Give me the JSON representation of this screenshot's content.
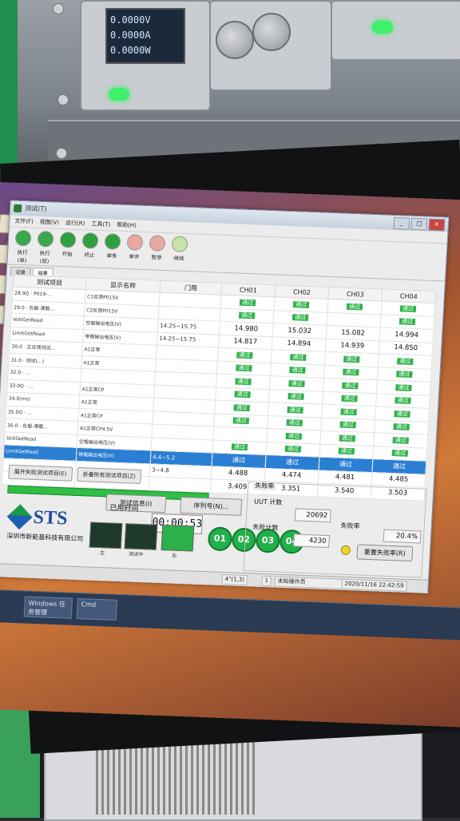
{
  "instrument": {
    "lcd_lines": [
      "0.0000V",
      "0.0000A",
      "0.0000W"
    ]
  },
  "window": {
    "title": "测试(T)",
    "controls": [
      "_",
      "□",
      "×"
    ]
  },
  "menu": [
    "文件(F)",
    "视图(V)",
    "运行(R)",
    "工具(T)",
    "帮助(H)"
  ],
  "toolbar": [
    {
      "label": "执行(单)",
      "color": "#3aa84a"
    },
    {
      "label": "执行(双)",
      "color": "#3aa84a"
    },
    {
      "label": "开始",
      "color": "#2f9f3f"
    },
    {
      "label": "终止",
      "color": "#2f9f3f"
    },
    {
      "label": "单条",
      "color": "#2f9f3f"
    },
    {
      "label": "单步",
      "color": "#e8a7a0"
    },
    {
      "label": "暂停",
      "color": "#e8a7a0"
    },
    {
      "label": "继续",
      "color": "#c6e3a8"
    }
  ],
  "tabs": [
    "记录",
    "结果"
  ],
  "grid": {
    "headers": [
      "测试项目",
      "显示名称",
      "门限",
      "CH01",
      "CH02",
      "CH03",
      "CH04"
    ],
    "rows": [
      {
        "item": "28.9Q · P019-...",
        "disp": "C1反馈P015V",
        "lim": "",
        "c": [
          "通过",
          "通过",
          "通过",
          "通过"
        ]
      },
      {
        "item": "29.0 · 负载-满载...",
        "disp": "C2反馈P015V",
        "lim": "",
        "c": [
          "通过",
          "通过",
          "",
          "通过"
        ]
      },
      {
        "item": "VoltGetRead",
        "disp": "空载输出电压(V)",
        "lim": "14.25~15.75",
        "c": [
          "14.980",
          "15.032",
          "15.082",
          "14.994"
        ]
      },
      {
        "item": "LimitGetRead",
        "disp": "带载输出电压(V)",
        "lim": "14.25~15.75",
        "c": [
          "14.817",
          "14.894",
          "14.939",
          "14.850"
        ]
      },
      {
        "item": "30.0 · 正反馈测试...",
        "disp": "A1正常",
        "lim": "",
        "c": [
          "通过",
          "通过",
          "通过",
          "通过"
        ]
      },
      {
        "item": "31.0 · 测试(...)",
        "disp": "A1正常",
        "lim": "",
        "c": [
          "通过",
          "通过",
          "通过",
          "通过"
        ]
      },
      {
        "item": "32.0 · ...",
        "disp": "",
        "lim": "",
        "c": [
          "通过",
          "通过",
          "通过",
          "通过"
        ]
      },
      {
        "item": "33.0Q · ...",
        "disp": "A1正常CP",
        "lim": "",
        "c": [
          "通过",
          "通过",
          "通过",
          "通过"
        ]
      },
      {
        "item": "34.0(ms)",
        "disp": "A1正常",
        "lim": "",
        "c": [
          "通过",
          "通过",
          "通过",
          "通过"
        ]
      },
      {
        "item": "35.0Q · ...",
        "disp": "A1正常CP",
        "lim": "",
        "c": [
          "通过",
          "通过",
          "通过",
          "通过"
        ]
      },
      {
        "item": "36.0 · 负载-满载...",
        "disp": "A1正常CP4.5V",
        "lim": "",
        "c": [
          "",
          "通过",
          "通过",
          "通过"
        ]
      },
      {
        "item": "VoltGetRead",
        "disp": "空载输出电压(V)",
        "lim": "",
        "c": [
          "通过",
          "通过",
          "通过",
          "通过"
        ]
      },
      {
        "item": "LimitGetRead",
        "disp": "带载输出电压(V)",
        "lim": "4.4~5.2",
        "c": [
          "通过",
          "通过",
          "通过",
          "通过"
        ],
        "sel": true
      },
      {
        "item": "",
        "disp": "",
        "lim": "3~4.8",
        "c": [
          "4.488",
          "4.474",
          "4.481",
          "4.485"
        ]
      },
      {
        "item": "",
        "disp": "",
        "lim": "",
        "c": [
          "3.409",
          "3.351",
          "3.540",
          "3.503"
        ]
      }
    ]
  },
  "buttons": {
    "b1": "展开失败测试项目(E)",
    "b2": "折叠所有测试项目(Z)",
    "info": "测试信息(I)",
    "serial": "序列号(N)..."
  },
  "logo": {
    "name": "STS",
    "company": "深圳市新能基科技有限公司",
    "version": ""
  },
  "timer": {
    "label": "已用时间",
    "value": "00:00:53"
  },
  "lamps": [
    "左",
    "测试中",
    "右"
  ],
  "channels": [
    "01",
    "02",
    "03",
    "04"
  ],
  "stats": {
    "title": "失败率",
    "uut_label": "UUT 计数",
    "uut_value": "20692",
    "fail_label": "失败计数",
    "fail_value": "4230",
    "rate_label": "失败率",
    "rate_value": "20.4%",
    "reset": "重置失败率(R)"
  },
  "status": {
    "zoom": "4\"(1,3)",
    "count": "1",
    "operator": "未知操作员",
    "datetime": "2020/11/16 22:42:59"
  },
  "taskbar": [
    "Windows 任务管理",
    "Cmd"
  ]
}
